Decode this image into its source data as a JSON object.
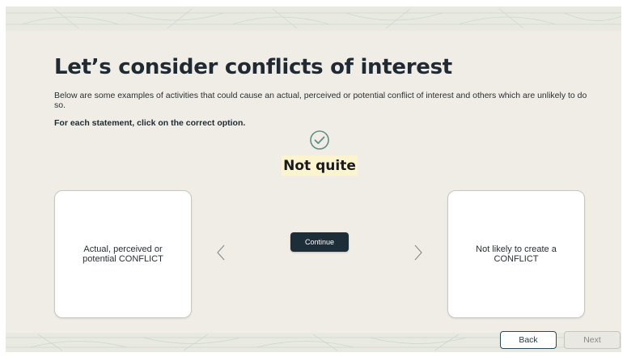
{
  "slide": {
    "title": "Let’s consider conflicts of interest",
    "description": "Below are some examples of activities that could cause an actual, perceived or potential conflict of interest and others which are unlikely to do so.",
    "instruction": "For each statement, click on the correct option.",
    "feedback": "Not quite"
  },
  "options": {
    "left": "Actual, perceived or potential CONFLICT",
    "right": "Not likely to create a CONFLICT"
  },
  "buttons": {
    "continue": "Continue",
    "back": "Back",
    "next": "Next"
  },
  "colors": {
    "background": "#efede6",
    "accent_dark": "#1e2e38",
    "feedback_highlight": "#fcf3cf",
    "check_icon": "#5f8f86",
    "band": "#e8eae2"
  },
  "icons": {
    "check": "check-circle-icon",
    "prev": "chevron-left-icon",
    "next": "chevron-right-icon"
  }
}
